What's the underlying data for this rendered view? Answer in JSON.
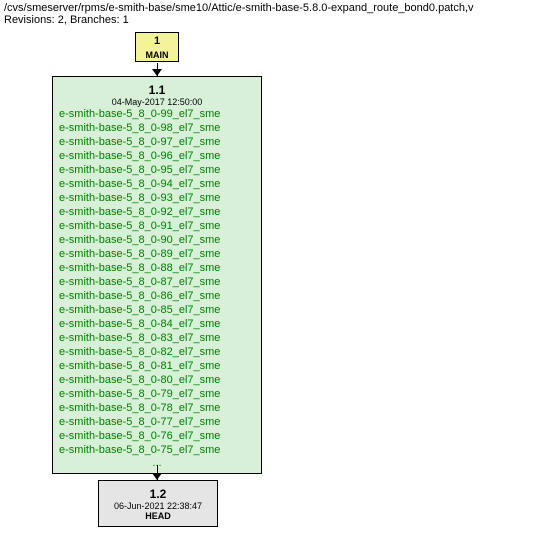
{
  "header": {
    "path": "/cvs/smeserver/rpms/e-smith-base/sme10/Attic/e-smith-base-5.8.0-expand_route_bond0.patch,v",
    "revinfo": "Revisions: 2, Branches: 1"
  },
  "branch": {
    "num": "1",
    "name": "MAIN"
  },
  "rev11": {
    "rev": "1.1",
    "date": "04-May-2017 12:50:00",
    "tags": [
      "e-smith-base-5_8_0-99_el7_sme",
      "e-smith-base-5_8_0-98_el7_sme",
      "e-smith-base-5_8_0-97_el7_sme",
      "e-smith-base-5_8_0-96_el7_sme",
      "e-smith-base-5_8_0-95_el7_sme",
      "e-smith-base-5_8_0-94_el7_sme",
      "e-smith-base-5_8_0-93_el7_sme",
      "e-smith-base-5_8_0-92_el7_sme",
      "e-smith-base-5_8_0-91_el7_sme",
      "e-smith-base-5_8_0-90_el7_sme",
      "e-smith-base-5_8_0-89_el7_sme",
      "e-smith-base-5_8_0-88_el7_sme",
      "e-smith-base-5_8_0-87_el7_sme",
      "e-smith-base-5_8_0-86_el7_sme",
      "e-smith-base-5_8_0-85_el7_sme",
      "e-smith-base-5_8_0-84_el7_sme",
      "e-smith-base-5_8_0-83_el7_sme",
      "e-smith-base-5_8_0-82_el7_sme",
      "e-smith-base-5_8_0-81_el7_sme",
      "e-smith-base-5_8_0-80_el7_sme",
      "e-smith-base-5_8_0-79_el7_sme",
      "e-smith-base-5_8_0-78_el7_sme",
      "e-smith-base-5_8_0-77_el7_sme",
      "e-smith-base-5_8_0-76_el7_sme",
      "e-smith-base-5_8_0-75_el7_sme"
    ],
    "ellipsis": "..."
  },
  "rev12": {
    "rev": "1.2",
    "date": "06-Jun-2021 22:38:47",
    "head": "HEAD"
  }
}
